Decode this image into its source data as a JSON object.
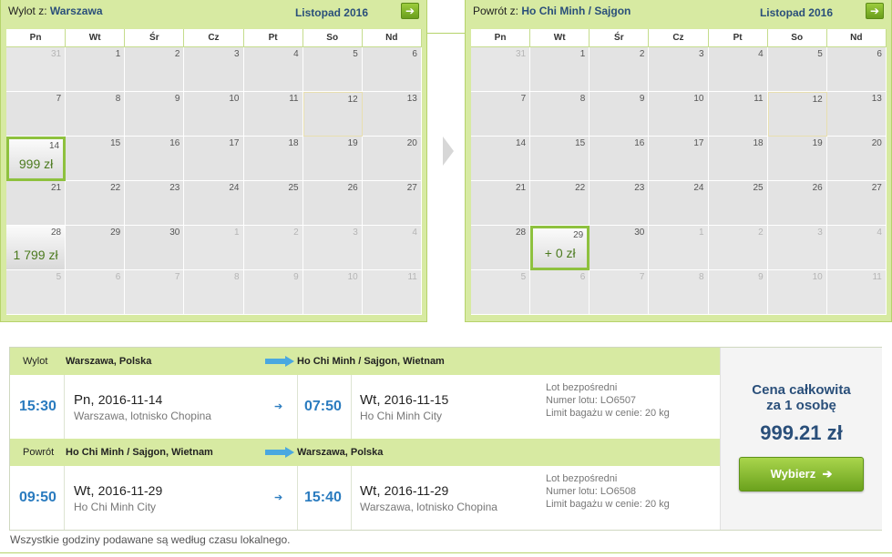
{
  "outbound": {
    "label": "Wylot z:",
    "city": "Warszawa",
    "month": "Listopad 2016",
    "weekdays": [
      "Pn",
      "Wt",
      "Śr",
      "Cz",
      "Pt",
      "So",
      "Nd"
    ],
    "weeks": [
      [
        {
          "d": "31",
          "other": true
        },
        {
          "d": "1"
        },
        {
          "d": "2"
        },
        {
          "d": "3"
        },
        {
          "d": "4"
        },
        {
          "d": "5"
        },
        {
          "d": "6"
        }
      ],
      [
        {
          "d": "7"
        },
        {
          "d": "8"
        },
        {
          "d": "9"
        },
        {
          "d": "10"
        },
        {
          "d": "11"
        },
        {
          "d": "12",
          "today": true
        },
        {
          "d": "13"
        }
      ],
      [
        {
          "d": "14",
          "price": "999 zł",
          "selected": true
        },
        {
          "d": "15"
        },
        {
          "d": "16"
        },
        {
          "d": "17"
        },
        {
          "d": "18"
        },
        {
          "d": "19"
        },
        {
          "d": "20"
        }
      ],
      [
        {
          "d": "21"
        },
        {
          "d": "22"
        },
        {
          "d": "23"
        },
        {
          "d": "24"
        },
        {
          "d": "25"
        },
        {
          "d": "26"
        },
        {
          "d": "27"
        }
      ],
      [
        {
          "d": "28",
          "price": "1 799 zł"
        },
        {
          "d": "29"
        },
        {
          "d": "30"
        },
        {
          "d": "1",
          "other": true
        },
        {
          "d": "2",
          "other": true
        },
        {
          "d": "3",
          "other": true
        },
        {
          "d": "4",
          "other": true
        }
      ],
      [
        {
          "d": "5",
          "other": true
        },
        {
          "d": "6",
          "other": true
        },
        {
          "d": "7",
          "other": true
        },
        {
          "d": "8",
          "other": true
        },
        {
          "d": "9",
          "other": true
        },
        {
          "d": "10",
          "other": true
        },
        {
          "d": "11",
          "other": true
        }
      ]
    ]
  },
  "return": {
    "label": "Powrót z:",
    "city": "Ho Chi Minh / Sajgon",
    "month": "Listopad 2016",
    "weekdays": [
      "Pn",
      "Wt",
      "Śr",
      "Cz",
      "Pt",
      "So",
      "Nd"
    ],
    "weeks": [
      [
        {
          "d": "31",
          "other": true
        },
        {
          "d": "1"
        },
        {
          "d": "2"
        },
        {
          "d": "3"
        },
        {
          "d": "4"
        },
        {
          "d": "5"
        },
        {
          "d": "6"
        }
      ],
      [
        {
          "d": "7"
        },
        {
          "d": "8"
        },
        {
          "d": "9"
        },
        {
          "d": "10"
        },
        {
          "d": "11"
        },
        {
          "d": "12",
          "today": true
        },
        {
          "d": "13"
        }
      ],
      [
        {
          "d": "14"
        },
        {
          "d": "15"
        },
        {
          "d": "16"
        },
        {
          "d": "17"
        },
        {
          "d": "18"
        },
        {
          "d": "19"
        },
        {
          "d": "20"
        }
      ],
      [
        {
          "d": "21"
        },
        {
          "d": "22"
        },
        {
          "d": "23"
        },
        {
          "d": "24"
        },
        {
          "d": "25"
        },
        {
          "d": "26"
        },
        {
          "d": "27"
        }
      ],
      [
        {
          "d": "28"
        },
        {
          "d": "29",
          "price": "+ 0 zł",
          "selected": true
        },
        {
          "d": "30"
        },
        {
          "d": "1",
          "other": true
        },
        {
          "d": "2",
          "other": true
        },
        {
          "d": "3",
          "other": true
        },
        {
          "d": "4",
          "other": true
        }
      ],
      [
        {
          "d": "5",
          "other": true
        },
        {
          "d": "6",
          "other": true
        },
        {
          "d": "7",
          "other": true
        },
        {
          "d": "8",
          "other": true
        },
        {
          "d": "9",
          "other": true
        },
        {
          "d": "10",
          "other": true
        },
        {
          "d": "11",
          "other": true
        }
      ]
    ]
  },
  "summary": {
    "outbound_leg": {
      "label": "Wylot",
      "from": "Warszawa, Polska",
      "to": "Ho Chi Minh / Sajgon, Wietnam",
      "dep_time": "15:30",
      "dep_day": "Pn,",
      "dep_date": "2016-11-14",
      "dep_place": "Warszawa, lotnisko Chopina",
      "arr_time": "07:50",
      "arr_day": "Wt,",
      "arr_date": "2016-11-15",
      "arr_place": "Ho Chi Minh City",
      "info1": "Lot bezpośredni",
      "info2": "Numer lotu: LO6507",
      "info3": "Limit bagażu w cenie: 20 kg"
    },
    "return_leg": {
      "label": "Powrót",
      "from": "Ho Chi Minh / Sajgon, Wietnam",
      "to": "Warszawa, Polska",
      "dep_time": "09:50",
      "dep_day": "Wt,",
      "dep_date": "2016-11-29",
      "dep_place": "Ho Chi Minh City",
      "arr_time": "15:40",
      "arr_day": "Wt,",
      "arr_date": "2016-11-29",
      "arr_place": "Warszawa, lotnisko Chopina",
      "info1": "Lot bezpośredni",
      "info2": "Numer lotu: LO6508",
      "info3": "Limit bagażu w cenie: 20 kg"
    },
    "price_title1": "Cena całkowita",
    "price_title2": "za 1 osobę",
    "total_price": "999.21 zł",
    "select_label": "Wybierz"
  },
  "footnote": "Wszystkie godziny podawane są według czasu lokalnego.",
  "colors": {
    "accent": "#8ec13e",
    "calendar_bg": "#d7eaa2",
    "time_blue": "#2a7bbf",
    "title_blue": "#2a4f7a"
  },
  "icons": {
    "next_month": "arrow-right-icon",
    "route_arrow": "big-arrow-right-icon",
    "small_arrow": "small-arrow-right-icon"
  }
}
